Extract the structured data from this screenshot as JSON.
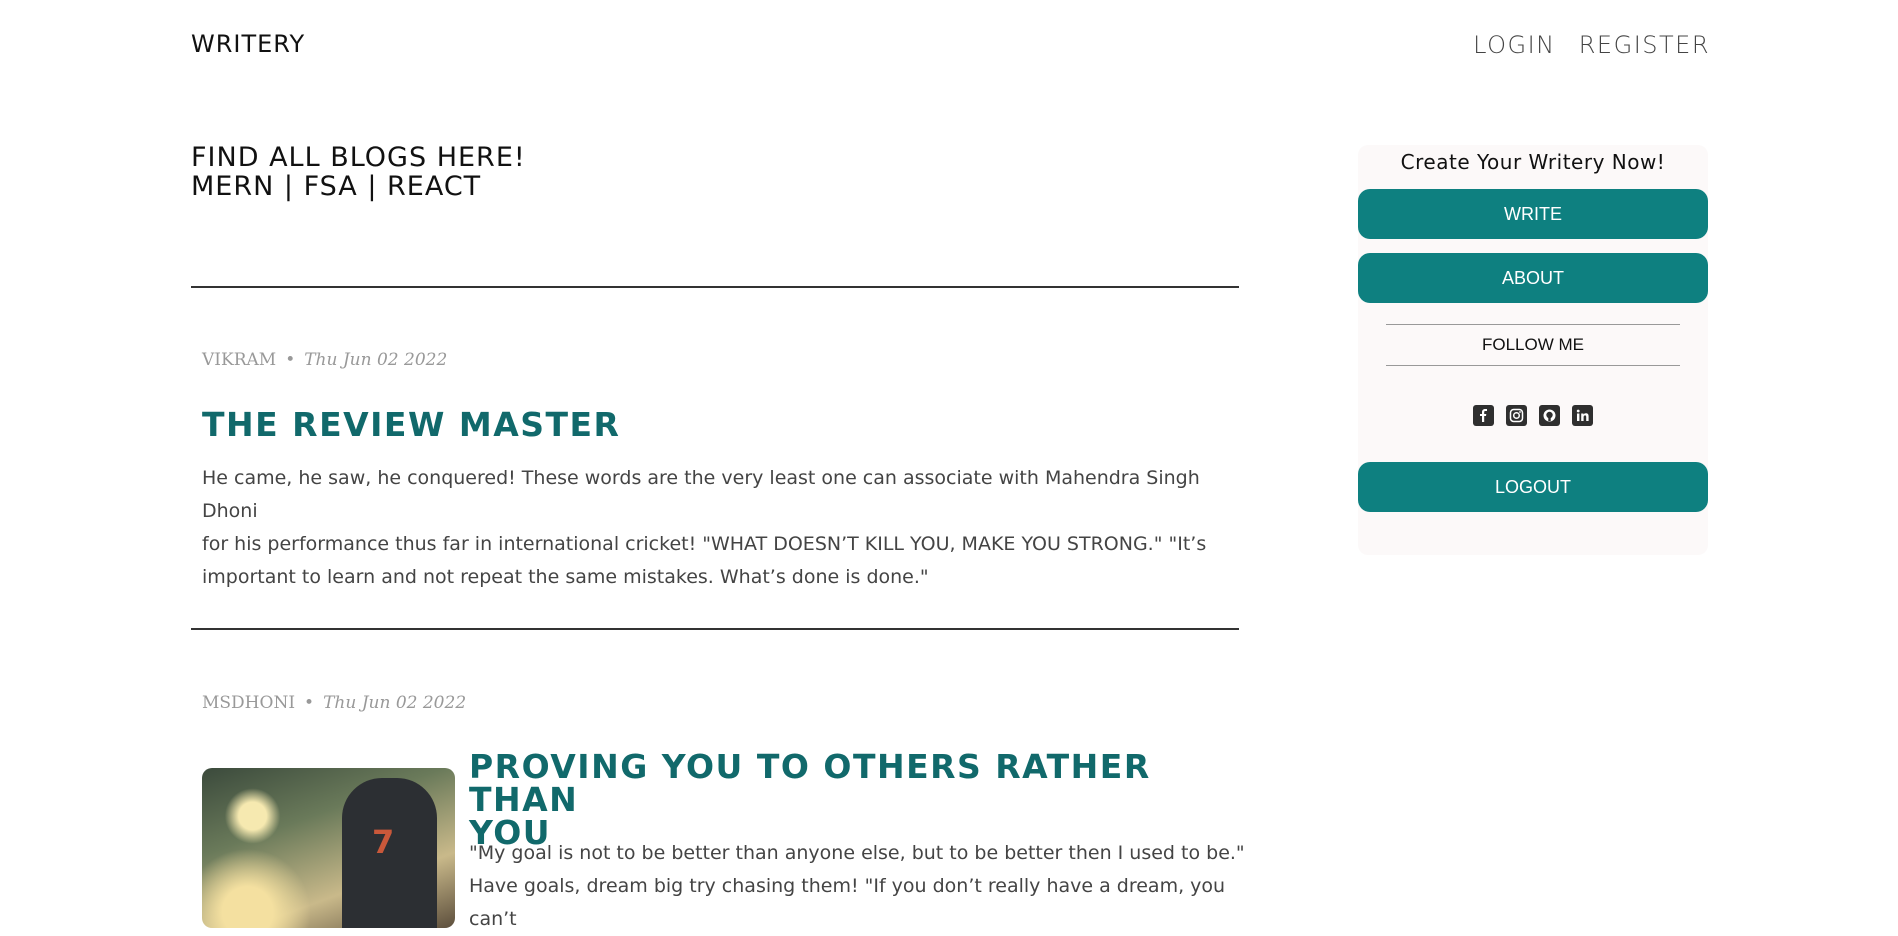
{
  "header": {
    "brand": "WRITERY",
    "login": "LOGIN",
    "register": "REGISTER"
  },
  "hero": {
    "line1": "FIND ALL BLOGS HERE!",
    "line2": "MERN | FSA | REACT"
  },
  "posts": [
    {
      "author": "VIKRAM",
      "separator": "•",
      "date": "Thu Jun 02 2022",
      "title": "THE REVIEW MASTER",
      "excerpt_lines": [
        "He came, he saw, he conquered! These words are the very least one can associate with Mahendra Singh Dhoni",
        "for his performance thus far in international cricket! \"WHAT DOESN’T KILL YOU, MAKE YOU STRONG.\" \"It’s",
        "important to learn and not repeat the same mistakes. What’s done is done.\""
      ]
    },
    {
      "author": "MSDHONI",
      "separator": "•",
      "date": "Thu Jun 02 2022",
      "title_lines": [
        "PROVING YOU TO OTHERS RATHER THAN",
        "YOU"
      ],
      "excerpt_lines": [
        "\"My goal is not to be better than anyone else, but to be better then I used to be.\"",
        "Have goals, dream big try chasing them! \"If you don’t really have a dream, you can’t"
      ],
      "image_text": "7"
    }
  ],
  "sidebar": {
    "title": "Create Your Writery Now!",
    "write": "WRITE",
    "about": "ABOUT",
    "follow": "FOLLOW ME",
    "logout": "LOGOUT",
    "social_icons": [
      "facebook-icon",
      "instagram-icon",
      "github-icon",
      "linkedin-icon"
    ]
  },
  "colors": {
    "accent": "#0e8080",
    "title": "#11696b"
  }
}
